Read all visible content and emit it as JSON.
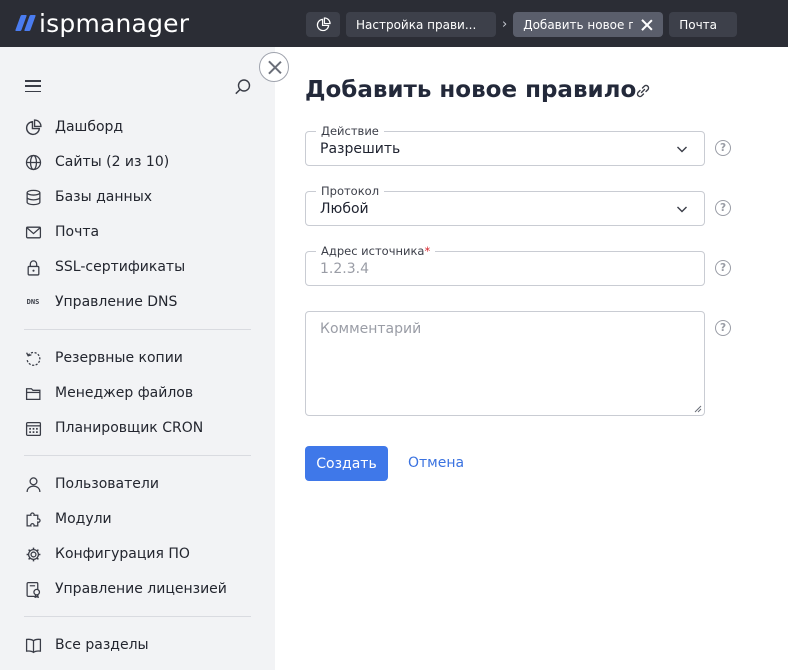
{
  "app": {
    "logo_text": "ispmanager",
    "brand_color": "#4a7cf0"
  },
  "tabs": [
    {
      "label": "Настройка прави..."
    },
    {
      "label": "Добавить новое п..."
    },
    {
      "label": "Почта"
    }
  ],
  "sidebar": {
    "items": [
      {
        "label": "Дашборд",
        "icon": "dashboard-icon"
      },
      {
        "label": "Сайты (2 из 10)",
        "icon": "globe-icon"
      },
      {
        "label": "Базы данных",
        "icon": "database-icon"
      },
      {
        "label": "Почта",
        "icon": "mail-icon"
      },
      {
        "label": "SSL-сертификаты",
        "icon": "lock-icon"
      },
      {
        "label": "Управление DNS",
        "icon": "dns-icon"
      },
      {
        "label": "Резервные копии",
        "icon": "backup-icon"
      },
      {
        "label": "Менеджер файлов",
        "icon": "folder-icon"
      },
      {
        "label": "Планировщик CRON",
        "icon": "calendar-icon"
      },
      {
        "label": "Пользователи",
        "icon": "user-icon"
      },
      {
        "label": "Модули",
        "icon": "puzzle-icon"
      },
      {
        "label": "Конфигурация ПО",
        "icon": "gear-icon"
      },
      {
        "label": "Управление лицензией",
        "icon": "license-icon"
      },
      {
        "label": "Все разделы",
        "icon": "book-icon"
      }
    ],
    "dns_icon_text": "DNS"
  },
  "main": {
    "title": "Добавить новое правило",
    "fields": {
      "action": {
        "label": "Действие",
        "value": "Разрешить"
      },
      "protocol": {
        "label": "Протокол",
        "value": "Любой"
      },
      "source": {
        "label": "Адрес источника",
        "required_mark": "*",
        "placeholder": "1.2.3.4"
      },
      "comment": {
        "placeholder": "Комментарий"
      }
    },
    "help_glyph": "?",
    "buttons": {
      "create": "Создать",
      "cancel": "Отмена"
    }
  }
}
